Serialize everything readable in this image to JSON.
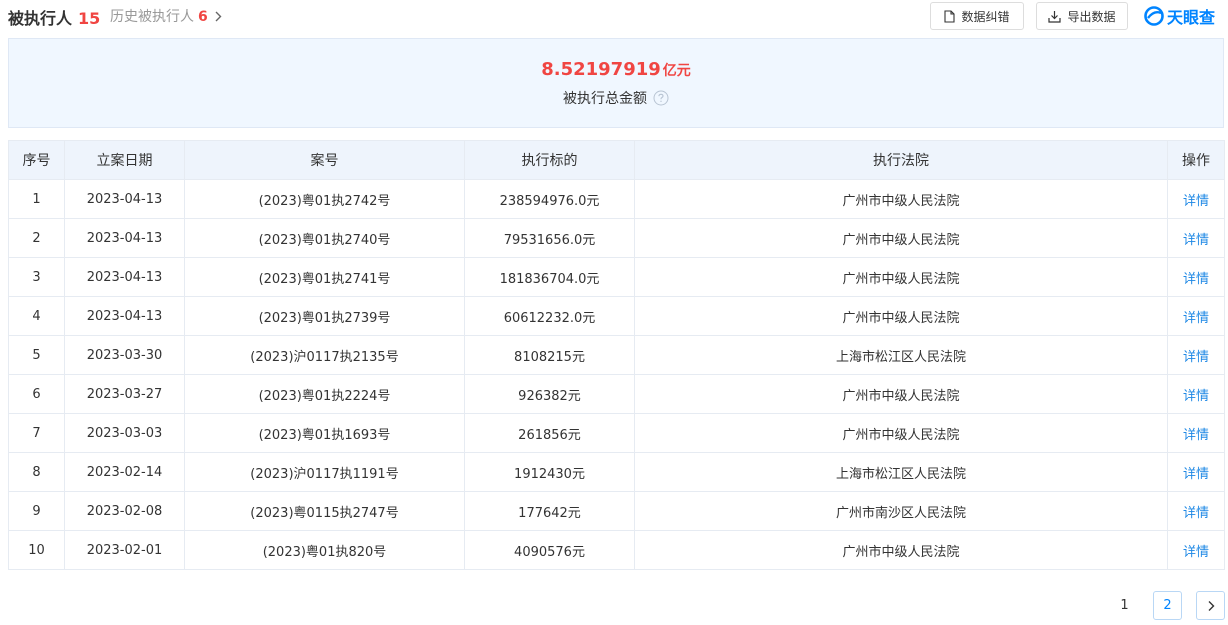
{
  "header": {
    "tab_main_label": "被执行人",
    "tab_main_count": "15",
    "tab_history_label": "历史被执行人",
    "tab_history_count": "6",
    "btn_correct": "数据纠错",
    "btn_export": "导出数据",
    "logo_text": "天眼查"
  },
  "summary": {
    "amount": "8.52197919",
    "unit": "亿元",
    "label": "被执行总金额"
  },
  "table": {
    "headers": [
      "序号",
      "立案日期",
      "案号",
      "执行标的",
      "执行法院",
      "操作"
    ],
    "rows": [
      {
        "no": "1",
        "date": "2023-04-13",
        "case": "(2023)粤01执2742号",
        "amount": "238594976.0元",
        "court": "广州市中级人民法院",
        "action": "详情"
      },
      {
        "no": "2",
        "date": "2023-04-13",
        "case": "(2023)粤01执2740号",
        "amount": "79531656.0元",
        "court": "广州市中级人民法院",
        "action": "详情"
      },
      {
        "no": "3",
        "date": "2023-04-13",
        "case": "(2023)粤01执2741号",
        "amount": "181836704.0元",
        "court": "广州市中级人民法院",
        "action": "详情"
      },
      {
        "no": "4",
        "date": "2023-04-13",
        "case": "(2023)粤01执2739号",
        "amount": "60612232.0元",
        "court": "广州市中级人民法院",
        "action": "详情"
      },
      {
        "no": "5",
        "date": "2023-03-30",
        "case": "(2023)沪0117执2135号",
        "amount": "8108215元",
        "court": "上海市松江区人民法院",
        "action": "详情"
      },
      {
        "no": "6",
        "date": "2023-03-27",
        "case": "(2023)粤01执2224号",
        "amount": "926382元",
        "court": "广州市中级人民法院",
        "action": "详情"
      },
      {
        "no": "7",
        "date": "2023-03-03",
        "case": "(2023)粤01执1693号",
        "amount": "261856元",
        "court": "广州市中级人民法院",
        "action": "详情"
      },
      {
        "no": "8",
        "date": "2023-02-14",
        "case": "(2023)沪0117执1191号",
        "amount": "1912430元",
        "court": "上海市松江区人民法院",
        "action": "详情"
      },
      {
        "no": "9",
        "date": "2023-02-08",
        "case": "(2023)粤0115执2747号",
        "amount": "177642元",
        "court": "广州市南沙区人民法院",
        "action": "详情"
      },
      {
        "no": "10",
        "date": "2023-02-01",
        "case": "(2023)粤01执820号",
        "amount": "4090576元",
        "court": "广州市中级人民法院",
        "action": "详情"
      }
    ]
  },
  "pagination": {
    "page_1": "1",
    "page_2": "2",
    "next_icon": "chevron-right-icon"
  },
  "colors": {
    "accent_red": "#f04542",
    "link_blue": "#1e88e5",
    "brand_blue": "#0084ff",
    "summary_bg": "#f0f7ff",
    "header_bg": "#eef4fc"
  }
}
